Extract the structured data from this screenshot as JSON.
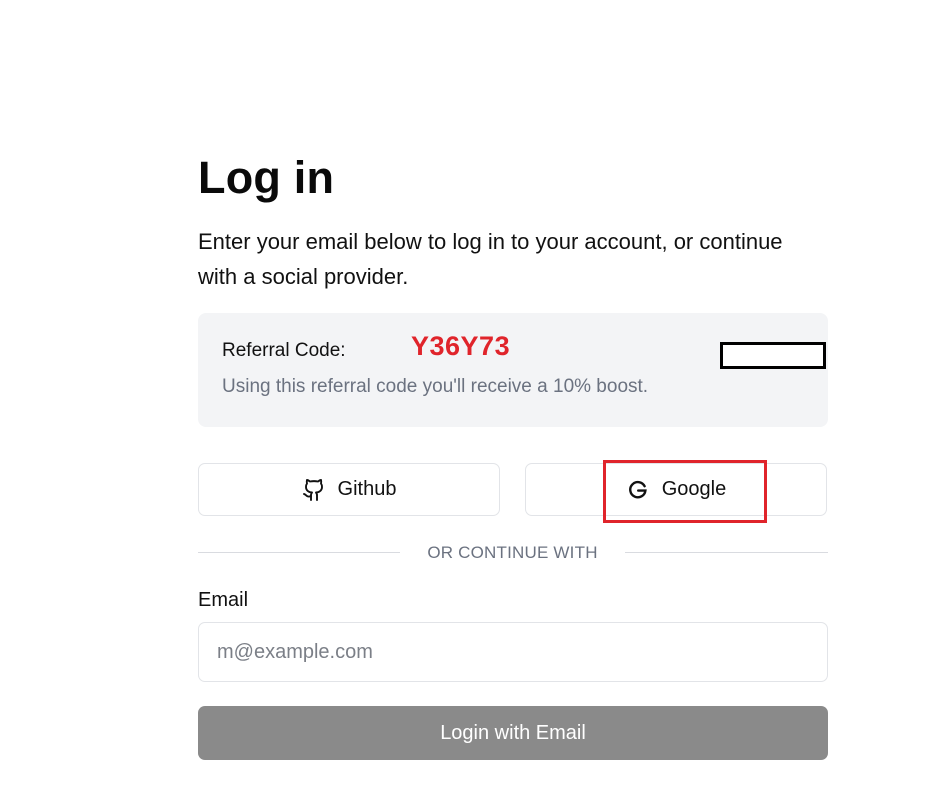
{
  "header": {
    "title": "Log in",
    "subtitle": "Enter your email below to log in to your account, or continue with a social provider."
  },
  "referral": {
    "label": "Referral Code:",
    "code": "Y36Y73",
    "note": "Using this referral code you'll receive a 10% boost.",
    "code_color": "#e0242b"
  },
  "social": {
    "github": {
      "label": "Github",
      "icon": "github-icon"
    },
    "google": {
      "label": "Google",
      "icon": "google-icon"
    }
  },
  "divider": {
    "text": "OR CONTINUE WITH"
  },
  "form": {
    "email_label": "Email",
    "email_value": "",
    "email_placeholder": "m@example.com",
    "submit_label": "Login with Email"
  },
  "colors": {
    "highlight": "#e0242b",
    "submit_bg": "#8a8a8a",
    "card_bg": "#f3f4f6"
  }
}
